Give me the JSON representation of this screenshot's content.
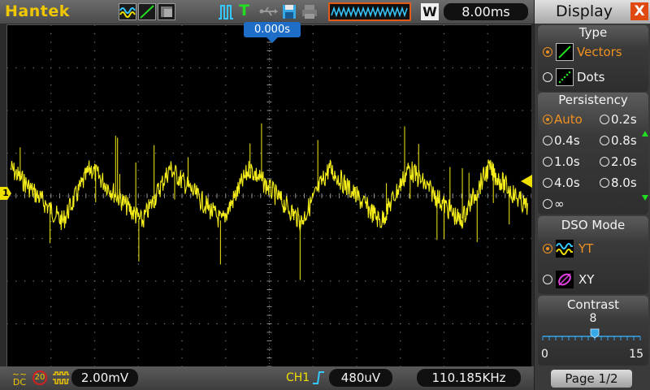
{
  "header": {
    "brand": "Hantek",
    "timebase": "8.00ms",
    "mode_letter": "W"
  },
  "icons": {
    "waveform": "yt-waveform-icon",
    "vector": "vector-draw-icon",
    "persistence": "persistence-icon",
    "trigger_mode": "trigger-mode-icon",
    "trigger": "trigger-T-icon",
    "usb": "usb-icon",
    "save": "save-icon",
    "print": "print-icon",
    "memory": "memory-waveform-icon"
  },
  "trigger_marker": {
    "position": "0.000s"
  },
  "channel_marker": {
    "label": "1"
  },
  "status_bar": {
    "coupling_top": "~~",
    "coupling_bottom": "DC",
    "bandwidth_limit": "20",
    "ch1_volts_div": "2.00mV",
    "trigger_source": "CH1",
    "trigger_level": "480uV",
    "frequency": "110.185KHz"
  },
  "menu": {
    "title": "Display",
    "close_label": "X",
    "type": {
      "title": "Type",
      "options": [
        {
          "label": "Vectors",
          "selected": true
        },
        {
          "label": "Dots",
          "selected": false
        }
      ]
    },
    "persistency": {
      "title": "Persistency",
      "options": [
        {
          "label": "Auto",
          "selected": true
        },
        {
          "label": "0.2s",
          "selected": false
        },
        {
          "label": "0.4s",
          "selected": false
        },
        {
          "label": "0.8s",
          "selected": false
        },
        {
          "label": "1.0s",
          "selected": false
        },
        {
          "label": "2.0s",
          "selected": false
        },
        {
          "label": "4.0s",
          "selected": false
        },
        {
          "label": "8.0s",
          "selected": false
        },
        {
          "label": "∞",
          "selected": false
        }
      ]
    },
    "dso_mode": {
      "title": "DSO Mode",
      "options": [
        {
          "label": "YT",
          "selected": true
        },
        {
          "label": "XY",
          "selected": false
        }
      ]
    },
    "contrast": {
      "title": "Contrast",
      "value": "8",
      "min": "0",
      "max": "15",
      "level": 8
    },
    "page": "Page 1/2"
  },
  "colors": {
    "trace": "#f5ee1a",
    "accent": "#f09020",
    "trigger_marker": "#1e6ec8",
    "brand": "#f0c800"
  }
}
